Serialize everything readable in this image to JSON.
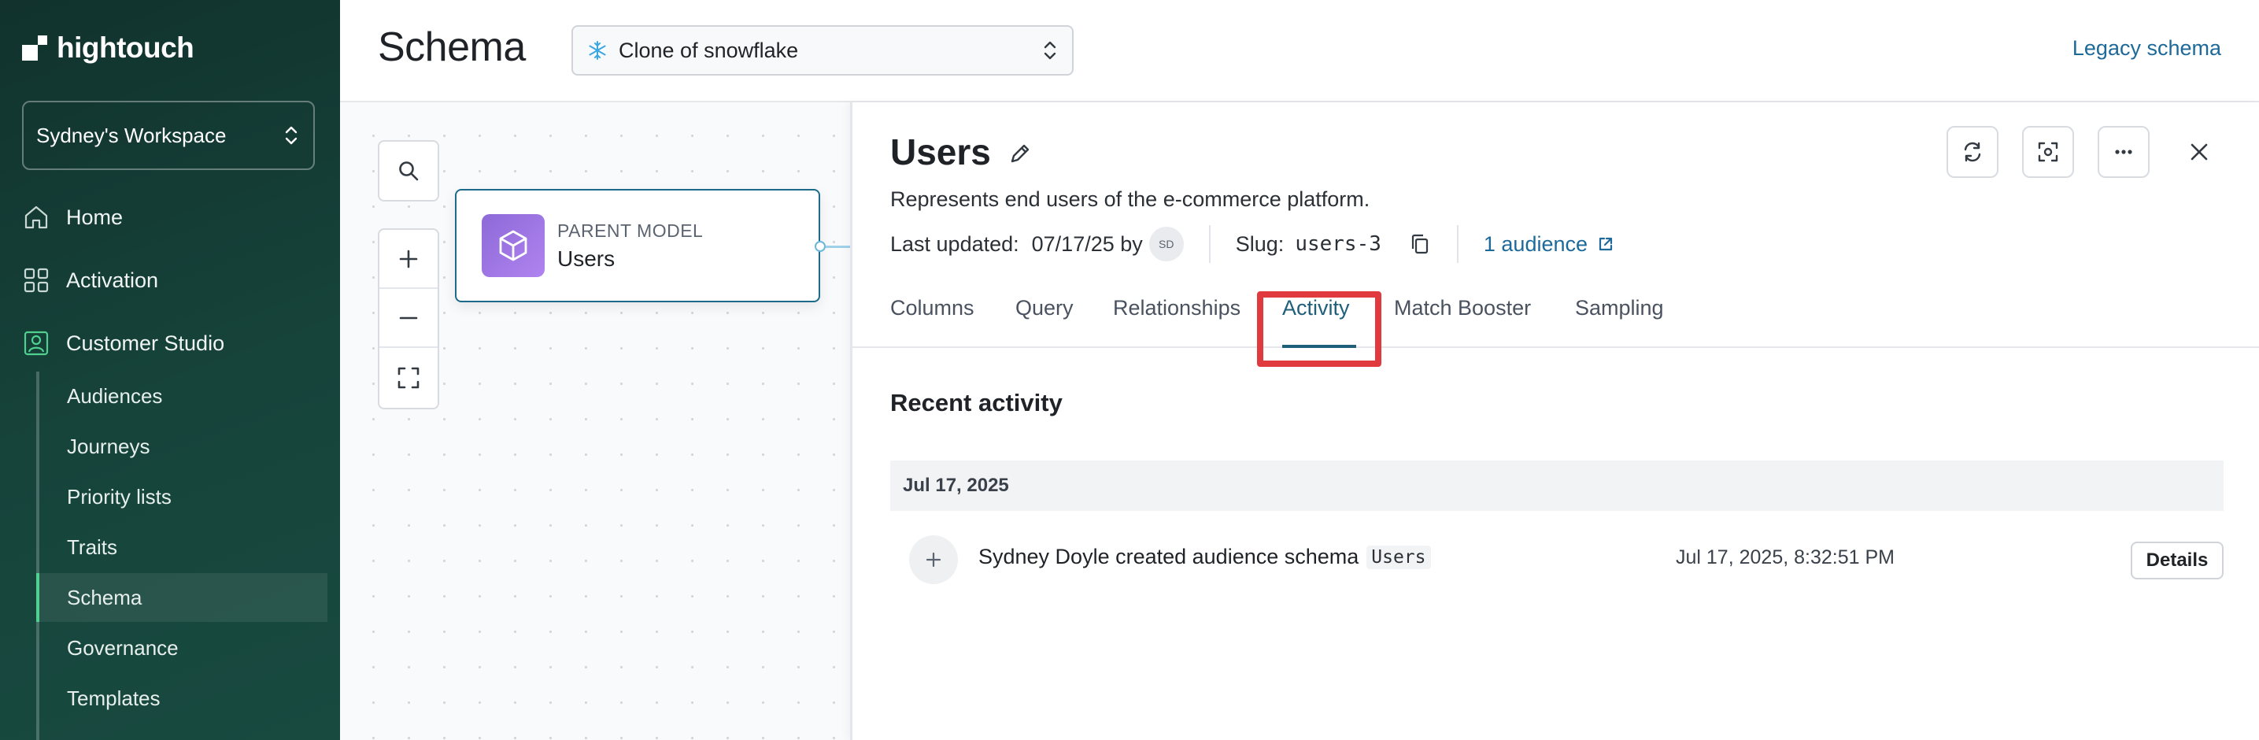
{
  "app": {
    "name": "hightouch"
  },
  "sidebar": {
    "workspace": "Sydney's Workspace",
    "nav": [
      {
        "label": "Home",
        "icon": "home-icon"
      },
      {
        "label": "Activation",
        "icon": "grid-icon"
      },
      {
        "label": "Customer Studio",
        "icon": "people-icon"
      }
    ],
    "sub_items": [
      "Audiences",
      "Journeys",
      "Priority lists",
      "Traits",
      "Schema",
      "Governance",
      "Templates"
    ],
    "active_sub_item": "Schema",
    "accent_color": "#4fd08f"
  },
  "header": {
    "title": "Schema",
    "source_select": {
      "icon": "snowflake-icon",
      "value": "Clone of snowflake"
    },
    "legacy_link": "Legacy schema"
  },
  "canvas": {
    "node": {
      "kicker": "PARENT MODEL",
      "name": "Users",
      "icon": "cube-icon"
    }
  },
  "panel": {
    "title": "Users",
    "description": "Represents end users of the e-commerce platform.",
    "last_updated_label": "Last updated:",
    "last_updated_value": "07/17/25 by",
    "avatar_initials": "SD",
    "slug_label": "Slug:",
    "slug_value": "users-3",
    "audience_link": "1 audience",
    "tabs": [
      "Columns",
      "Query",
      "Relationships",
      "Activity",
      "Match Booster",
      "Sampling"
    ],
    "active_tab": "Activity",
    "section_title": "Recent activity",
    "activity_date": "Jul 17, 2025",
    "activity": {
      "text": "Sydney Doyle created audience schema",
      "object": "Users",
      "timestamp": "Jul 17, 2025, 8:32:51 PM",
      "details_label": "Details"
    }
  },
  "colors": {
    "link": "#1d6a9a",
    "highlight": "#e0393e",
    "active_tab": "#1f5f7a"
  }
}
